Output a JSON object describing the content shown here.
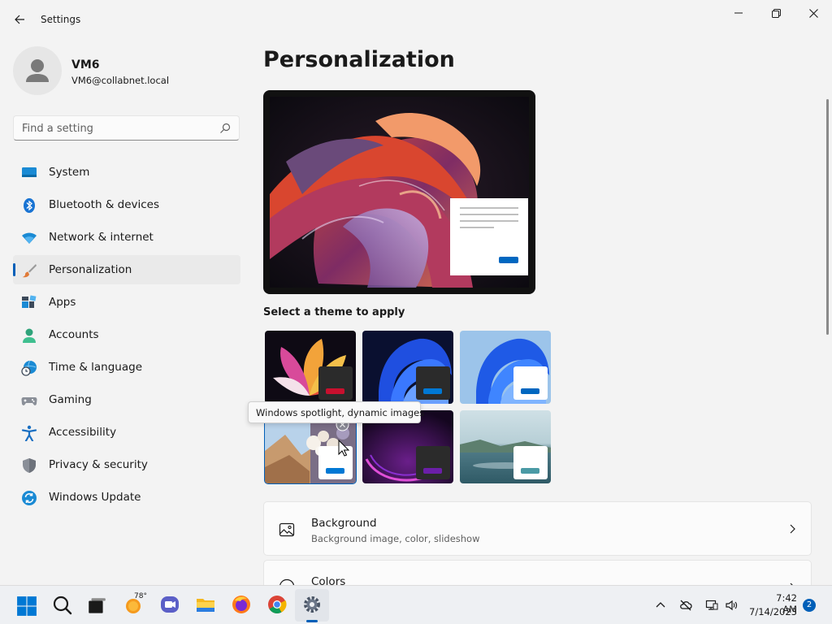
{
  "window": {
    "title": "Settings"
  },
  "profile": {
    "name": "VM6",
    "email": "VM6@collabnet.local"
  },
  "search": {
    "placeholder": "Find a setting"
  },
  "sidebar": {
    "items": [
      {
        "label": "System",
        "icon": "system-icon"
      },
      {
        "label": "Bluetooth & devices",
        "icon": "bluetooth-icon"
      },
      {
        "label": "Network & internet",
        "icon": "wifi-icon"
      },
      {
        "label": "Personalization",
        "icon": "brush-icon",
        "active": true
      },
      {
        "label": "Apps",
        "icon": "apps-icon"
      },
      {
        "label": "Accounts",
        "icon": "accounts-icon"
      },
      {
        "label": "Time & language",
        "icon": "globe-clock-icon"
      },
      {
        "label": "Gaming",
        "icon": "gamepad-icon"
      },
      {
        "label": "Accessibility",
        "icon": "accessibility-icon"
      },
      {
        "label": "Privacy & security",
        "icon": "shield-icon"
      },
      {
        "label": "Windows Update",
        "icon": "update-icon"
      }
    ]
  },
  "main": {
    "title": "Personalization",
    "themes_label": "Select a theme to apply",
    "tooltip": "Windows spotlight, dynamic images",
    "cards": [
      {
        "title": "Background",
        "subtitle": "Background image, color, slideshow",
        "icon": "image-icon"
      },
      {
        "title": "Colors",
        "subtitle": "",
        "icon": "palette-icon"
      }
    ]
  },
  "taskbar": {
    "weather_temp": "78°",
    "time": "7:42 AM",
    "date": "7/14/2023",
    "notifications": "2"
  },
  "colors": {
    "accent": "#005fb8"
  }
}
